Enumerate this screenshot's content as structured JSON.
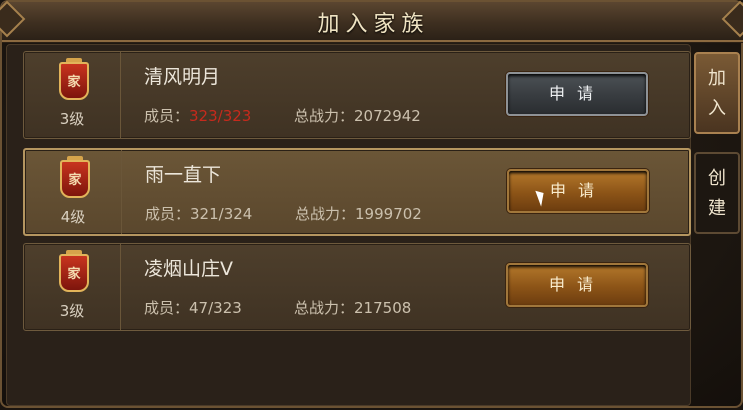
{
  "window": {
    "title": "加入家族"
  },
  "tabs": [
    {
      "label": "加\n入",
      "active": true
    },
    {
      "label": "创\n建",
      "active": false
    }
  ],
  "families": [
    {
      "badge_glyph": "家",
      "level": "3级",
      "name": "清风明月",
      "members_label": "成员：",
      "members_value": "323/323",
      "power_label": "总战力：",
      "power_value": "2072942",
      "apply_label": "申请",
      "apply_state": "disabled"
    },
    {
      "badge_glyph": "家",
      "level": "4级",
      "name": "雨一直下",
      "members_label": "成员：",
      "members_value": "321/324",
      "power_label": "总战力：",
      "power_value": "1999702",
      "apply_label": "申请",
      "apply_state": "enabled"
    },
    {
      "badge_glyph": "家",
      "level": "3级",
      "name": "凌烟山庄V",
      "members_label": "成员：",
      "members_value": "47/323",
      "power_label": "总战力：",
      "power_value": "217508",
      "apply_label": "申请",
      "apply_state": "enabled"
    }
  ],
  "colors": {
    "accent": "#b59660",
    "full_members": "#c62a1c",
    "button_gold": "#8c5417",
    "button_grey": "#383c40"
  }
}
